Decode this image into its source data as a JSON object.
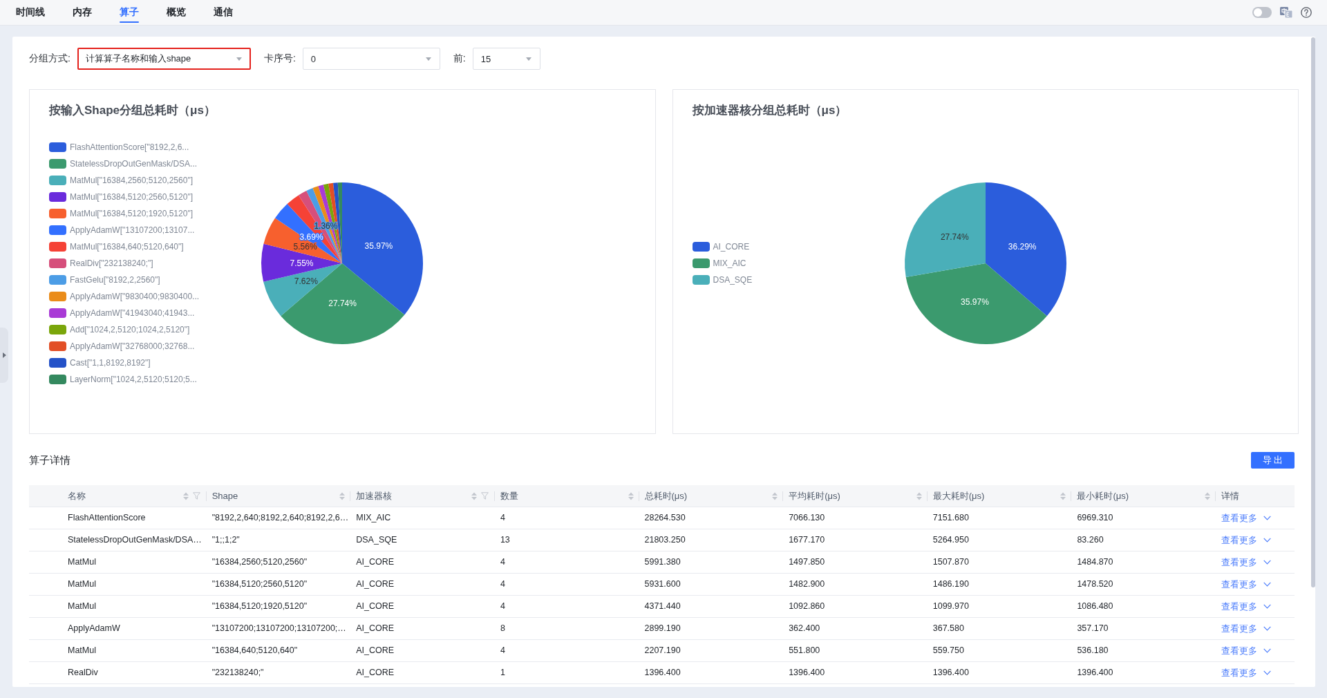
{
  "tabs": [
    {
      "label": "时间线",
      "selected": false
    },
    {
      "label": "内存",
      "selected": false
    },
    {
      "label": "算子",
      "selected": true
    },
    {
      "label": "概览",
      "selected": false
    },
    {
      "label": "通信",
      "selected": false
    }
  ],
  "toggle": {
    "on": false
  },
  "filters": [
    {
      "label": "分组方式:",
      "value": "计算算子名称和输入shape",
      "highlighted": true
    },
    {
      "label": "卡序号:",
      "value": "0",
      "highlighted": false
    },
    {
      "label": "前:",
      "value": "15",
      "highlighted": false
    }
  ],
  "charts": [
    {
      "chart_data": {
        "type": "pie",
        "title": "按输入Shape分组总耗时（μs）",
        "legend": "left",
        "categories": [
          "FlashAttentionScore[\"8192,2,6...",
          "StatelessDropOutGenMask/DSA...",
          "MatMul[\"16384,2560;5120,2560\"]",
          "MatMul[\"16384,5120;2560,5120\"]",
          "MatMul[\"16384,5120;1920,5120\"]",
          "ApplyAdamW[\"13107200;13107...",
          "MatMul[\"16384,640;5120,640\"]",
          "RealDiv[\"232138240;\"]",
          "FastGelu[\"8192,2,2560\"]",
          "ApplyAdamW[\"9830400;9830400...",
          "ApplyAdamW[\"41943040;41943...",
          "Add[\"1024,2,5120;1024,2,5120\"]",
          "ApplyAdamW[\"32768000;32768...",
          "Cast[\"1,1,8192,8192\"]",
          "LayerNorm[\"1024,2,5120;5120;5..."
        ],
        "values": [
          35.97,
          27.74,
          7.62,
          7.55,
          5.56,
          3.69,
          2.81,
          1.78,
          1.36,
          1.15,
          1.05,
          1.0,
          0.95,
          0.92,
          0.85
        ],
        "colors": [
          "#2b5ddc",
          "#3b9a6e",
          "#4aafb9",
          "#6a2bdc",
          "#f7602e",
          "#3370ff",
          "#f54236",
          "#d64f7b",
          "#4c9de6",
          "#ea8c1a",
          "#a93ad6",
          "#7aa60b",
          "#e24f26",
          "#2452c8",
          "#34895f"
        ],
        "value_labels": [
          "35.97%",
          "27.74%",
          "7.62%",
          "7.55%",
          "5.56%",
          "3.69%",
          null,
          null,
          "1.36%",
          null,
          null,
          null,
          null,
          null,
          null
        ]
      }
    },
    {
      "chart_data": {
        "type": "pie",
        "title": "按加速器核分组总耗时（μs）",
        "legend": "left",
        "categories": [
          "AI_CORE",
          "MIX_AIC",
          "DSA_SQE"
        ],
        "values": [
          36.29,
          35.97,
          27.74
        ],
        "colors": [
          "#2b5ddc",
          "#3b9a6e",
          "#4aafb9"
        ],
        "value_labels": [
          "36.29%",
          "35.97%",
          "27.74%"
        ]
      }
    }
  ],
  "details": {
    "title": "算子详情",
    "export_label": "导 出",
    "columns": [
      {
        "label": "名称",
        "sortable": true,
        "filterable": true
      },
      {
        "label": "Shape",
        "sortable": true,
        "filterable": false
      },
      {
        "label": "加速器核",
        "sortable": true,
        "filterable": true
      },
      {
        "label": "数量",
        "sortable": true,
        "filterable": false
      },
      {
        "label": "总耗时(μs)",
        "sortable": true,
        "filterable": false
      },
      {
        "label": "平均耗时(μs)",
        "sortable": true,
        "filterable": false
      },
      {
        "label": "最大耗时(μs)",
        "sortable": true,
        "filterable": false
      },
      {
        "label": "最小耗时(μs)",
        "sortable": true,
        "filterable": false
      },
      {
        "label": "详情",
        "sortable": false,
        "filterable": false
      }
    ],
    "rows": [
      {
        "cells": [
          "FlashAttentionScore",
          "\"8192,2,640;8192,2,640;8192,2,6…",
          "MIX_AIC",
          "4",
          "28264.530",
          "7066.130",
          "7151.680",
          "6969.310"
        ],
        "detail": "查看更多"
      },
      {
        "cells": [
          "StatelessDropOutGenMask/DSA…",
          "\"1;;1;2\"",
          "DSA_SQE",
          "13",
          "21803.250",
          "1677.170",
          "5264.950",
          "83.260"
        ],
        "detail": "查看更多"
      },
      {
        "cells": [
          "MatMul",
          "\"16384,2560;5120,2560\"",
          "AI_CORE",
          "4",
          "5991.380",
          "1497.850",
          "1507.870",
          "1484.870"
        ],
        "detail": "查看更多"
      },
      {
        "cells": [
          "MatMul",
          "\"16384,5120;2560,5120\"",
          "AI_CORE",
          "4",
          "5931.600",
          "1482.900",
          "1486.190",
          "1478.520"
        ],
        "detail": "查看更多"
      },
      {
        "cells": [
          "MatMul",
          "\"16384,5120;1920,5120\"",
          "AI_CORE",
          "4",
          "4371.440",
          "1092.860",
          "1099.970",
          "1086.480"
        ],
        "detail": "查看更多"
      },
      {
        "cells": [
          "ApplyAdamW",
          "\"13107200;13107200;13107200;…",
          "AI_CORE",
          "8",
          "2899.190",
          "362.400",
          "367.580",
          "357.170"
        ],
        "detail": "查看更多"
      },
      {
        "cells": [
          "MatMul",
          "\"16384,640;5120,640\"",
          "AI_CORE",
          "4",
          "2207.190",
          "551.800",
          "559.750",
          "536.180"
        ],
        "detail": "查看更多"
      },
      {
        "cells": [
          "RealDiv",
          "\"232138240;\"",
          "AI_CORE",
          "1",
          "1396.400",
          "1396.400",
          "1396.400",
          "1396.400"
        ],
        "detail": "查看更多"
      }
    ]
  }
}
